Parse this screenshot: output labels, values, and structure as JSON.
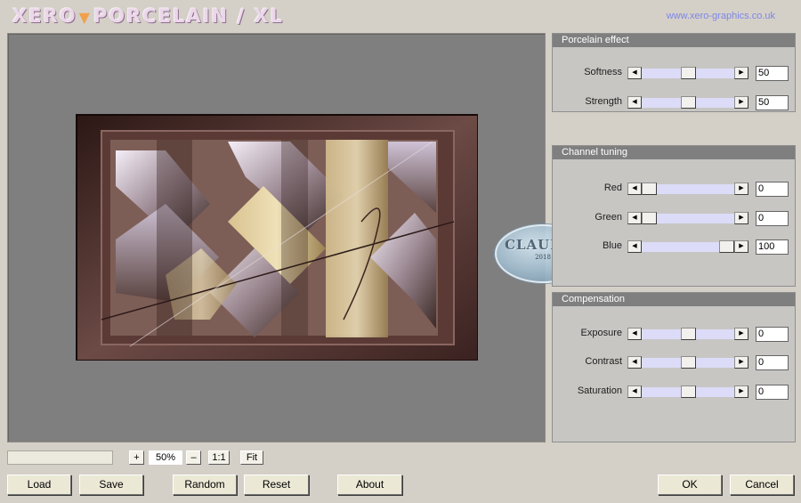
{
  "header": {
    "logo_left": "XERO",
    "logo_mid": "PORCELAIN",
    "logo_right": "/ XL",
    "url": "www.xero-graphics.co.uk"
  },
  "panels": {
    "porcelain": {
      "title": "Porcelain effect",
      "softness": {
        "label": "Softness",
        "value": "50"
      },
      "strength": {
        "label": "Strength",
        "value": "50"
      }
    },
    "channel": {
      "title": "Channel tuning",
      "red": {
        "label": "Red",
        "value": "0"
      },
      "green": {
        "label": "Green",
        "value": "0"
      },
      "blue": {
        "label": "Blue",
        "value": "100"
      }
    },
    "compensation": {
      "title": "Compensation",
      "exposure": {
        "label": "Exposure",
        "value": "0"
      },
      "contrast": {
        "label": "Contrast",
        "value": "0"
      },
      "saturation": {
        "label": "Saturation",
        "value": "0"
      }
    }
  },
  "zoom": {
    "plus": "+",
    "minus": "–",
    "value": "50%",
    "one_to_one": "1:1",
    "fit": "Fit"
  },
  "buttons": {
    "load": "Load",
    "save": "Save",
    "random": "Random",
    "reset": "Reset",
    "about": "About",
    "ok": "OK",
    "cancel": "Cancel"
  },
  "watermark": {
    "text": "CLAUDIA",
    "small": "2018"
  },
  "icons": {
    "slider_left": "triangle-left-icon",
    "slider_right": "triangle-right-icon"
  },
  "colors": {
    "panel_title_bg": "#7f7f7f",
    "slider_track": "#dcdcf8",
    "url": "#7d86e8"
  }
}
